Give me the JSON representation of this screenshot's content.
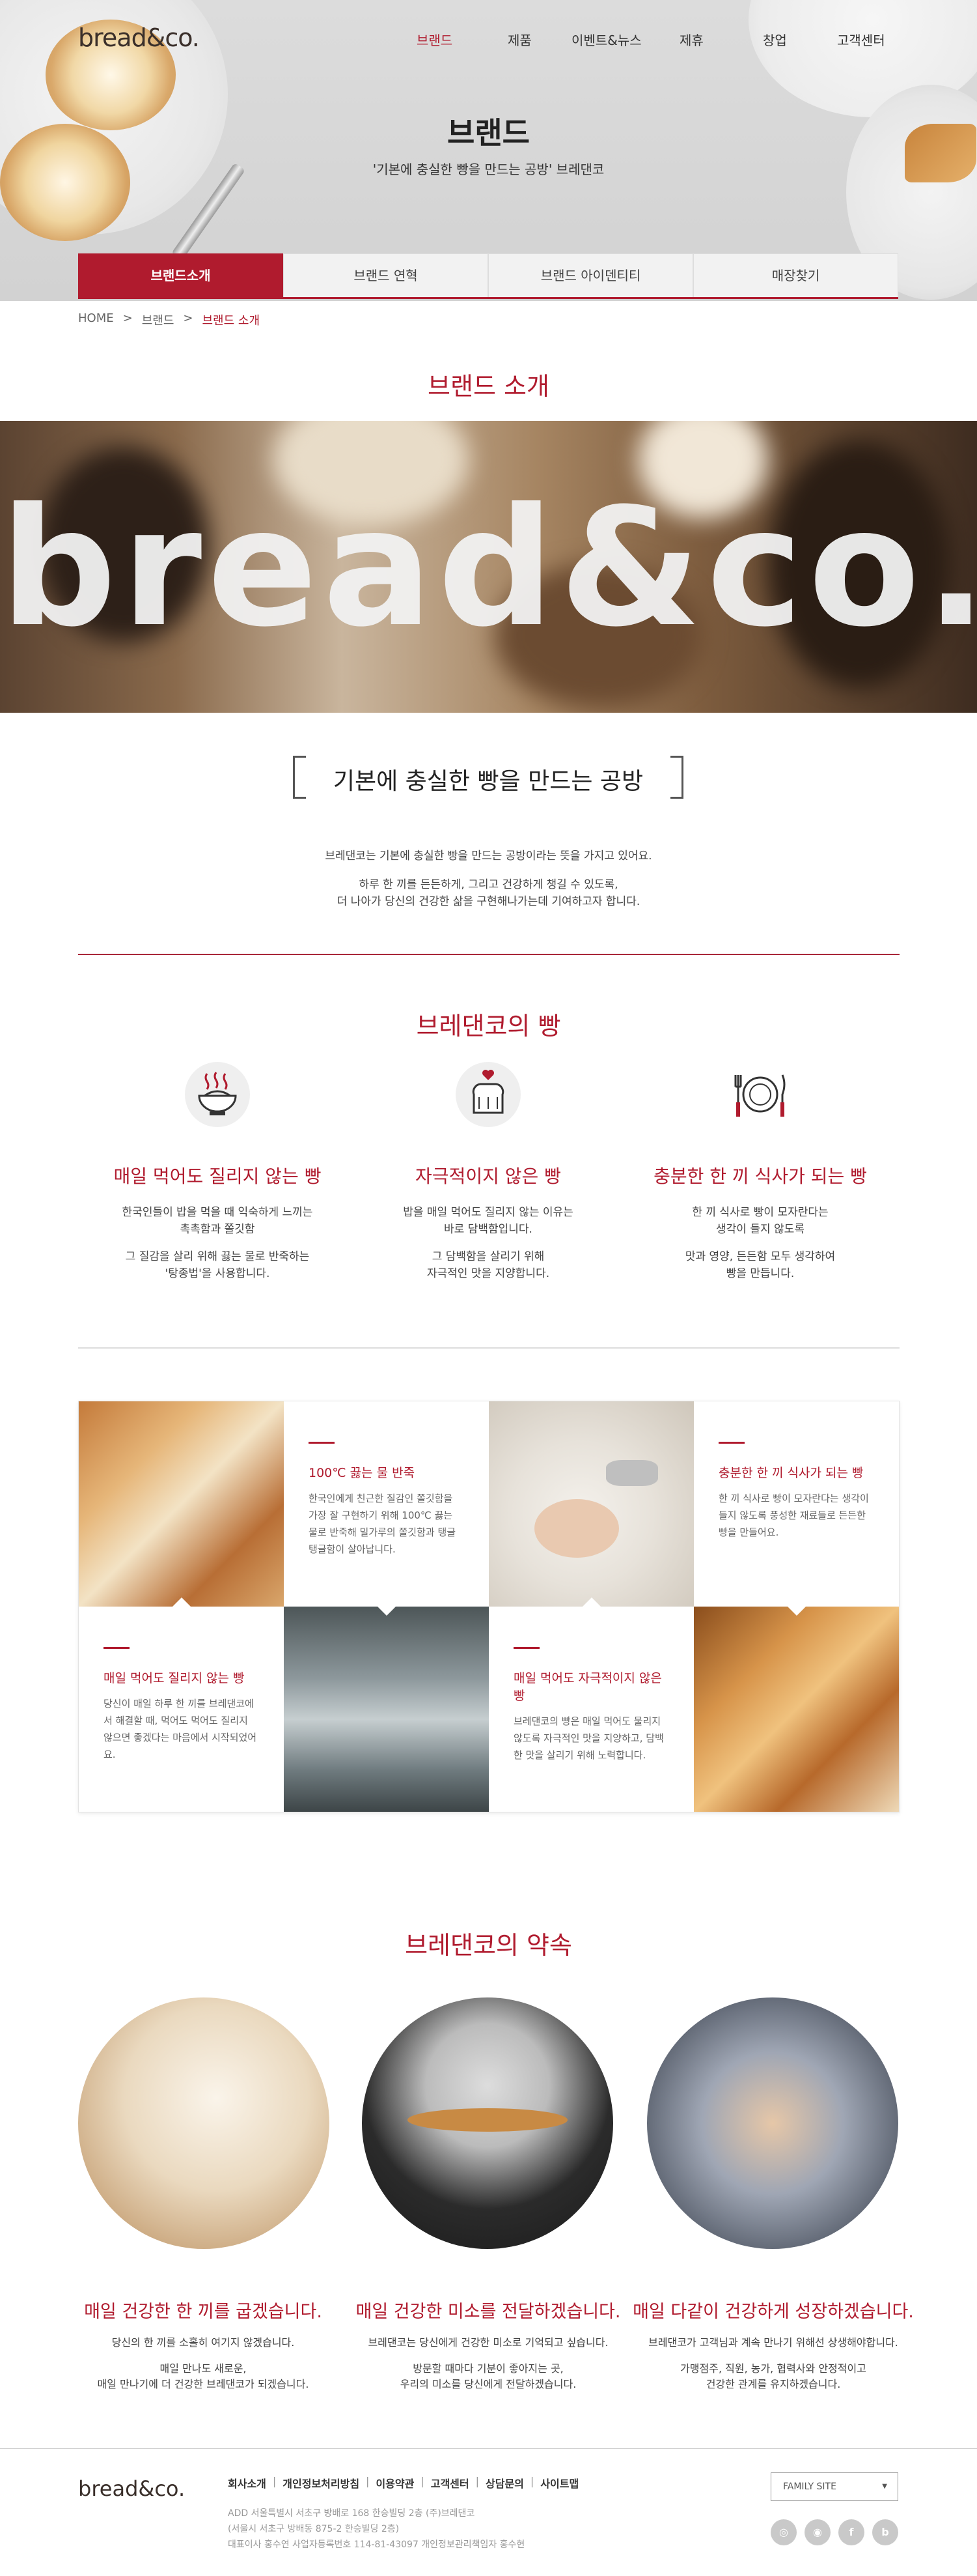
{
  "header": {
    "logo": "bread&co.",
    "nav": [
      "브랜드",
      "제품",
      "이벤트&뉴스",
      "제휴",
      "창업",
      "고객센터"
    ],
    "active_nav": 0,
    "title": "브랜드",
    "subtitle": "'기본에 충실한 빵을 만드는 공방' 브레댄코"
  },
  "tabs": [
    "브랜드소개",
    "브랜드 연혁",
    "브랜드 아이덴티티",
    "매장찾기"
  ],
  "breadcrumb": [
    "HOME",
    ">",
    "브랜드",
    ">",
    "브랜드 소개"
  ],
  "section1": {
    "title": "브랜드 소개",
    "banner_text": "bread&co.",
    "bracket_title": "기본에 충실한 빵을 만드는 공방",
    "para1": "브레댄코는 기본에 충실한 빵을 만드는 공방이라는 뜻을 가지고 있어요.",
    "para2": "하루 한 끼를 든든하게, 그리고 건강하게 챙길 수 있도록,",
    "para3": "더 나아가 당신의 건강한 삶을 구현해나가는데 기여하고자 합니다."
  },
  "section2": {
    "title": "브레댄코의 빵",
    "features": [
      {
        "icon": "rice-bowl-icon",
        "title": "매일 먹어도 질리지 않는 빵",
        "line1": "한국인들이 밥을 먹을 때 익숙하게 느끼는",
        "line2": "촉촉함과 쫄깃함",
        "line3": "그 질감을 살리 위해 끓는 물로 반죽하는",
        "line4": "'탕종법'을 사용합니다."
      },
      {
        "icon": "bread-heart-icon",
        "title": "자극적이지 않은 빵",
        "line1": "밥을 매일 먹어도 질리지 않는 이유는",
        "line2": "바로 담백함입니다.",
        "line3": "그 담백함을 살리기 위해",
        "line4": "자극적인 맛을 지양합니다."
      },
      {
        "icon": "plate-utensils-icon",
        "title": "충분한 한 끼 식사가 되는 빵",
        "line1": "한 끼 식사로 빵이 모자란다는",
        "line2": "생각이 들지 않도록",
        "line3": "맛과 영양, 든든함 모두 생각하여",
        "line4": "빵을 만듭니다."
      }
    ],
    "grid": [
      {
        "title": "100℃ 끓는 물 반죽",
        "desc": "한국인에게 친근한 질감인 쫄깃함을 가장 잘 구현하기 위해 100℃ 끓는 물로 반죽해 밀가루의 쫄깃함과 탱글탱글함이 살아납니다."
      },
      {
        "title": "충분한 한 끼 식사가 되는 빵",
        "desc": "한 끼 식사로 빵이 모자란다는 생각이 들지 않도록 풍성한 재료들로 든든한 빵을 만들어요."
      },
      {
        "title": "매일 먹어도 질리지 않는 빵",
        "desc": "당신이 매일 하루 한 끼를 브레댄코에서 해결할 때, 먹어도 먹어도 질리지 않으면 좋겠다는 마음에서 시작되었어요."
      },
      {
        "title": "매일 먹어도 자극적이지 않은 빵",
        "desc": "브레댄코의 빵은 매일 먹어도 물리지 않도록 자극적인 맛을 지양하고, 담백한 맛을 살리기 위해 노력합니다."
      }
    ]
  },
  "section3": {
    "title": "브레댄코의 약속",
    "promises": [
      {
        "title": "매일 건강한 한 끼를 굽겠습니다.",
        "line1": "당신의 한 끼를 소홀히 여기지 않겠습니다.",
        "line2": "매일 만나도 새로운,",
        "line3": "매일 만나기에 더 건강한 브레댄코가 되겠습니다."
      },
      {
        "title": "매일 건강한 미소를 전달하겠습니다.",
        "line1": "브레댄코는 당신에게 건강한 미소로 기억되고 싶습니다.",
        "line2": "방문할 때마다 기분이 좋아지는 곳,",
        "line3": "우리의 미소를 당신에게 전달하겠습니다."
      },
      {
        "title": "매일 다같이 건강하게 성장하겠습니다.",
        "line1": "브레댄코가 고객님과 계속 만나기 위해선 상생해야합니다.",
        "line2": "가맹점주, 직원, 농가, 협력사와 안정적이고",
        "line3": "건강한 관계를 유지하겠습니다."
      }
    ]
  },
  "footer": {
    "logo": "bread&co.",
    "links": [
      "회사소개",
      "개인정보처리방침",
      "이용약관",
      "고객센터",
      "상담문의",
      "사이트맵"
    ],
    "addr1": "ADD 서울특별시 서초구 방배로 168 한승빌딩 2층 (주)브레댄코",
    "addr2": "(서울시 서초구 방배동 875-2 한승빌딩 2층)",
    "addr3": "대표이사 홍수연    사업자등록번호 114-81-43097    개인정보관리책임자 홍수현",
    "family_site": "FAMILY SITE",
    "sns": [
      "instagram-icon",
      "instagram-icon",
      "facebook-icon",
      "blog-icon"
    ]
  },
  "colors": {
    "accent": "#b01b2e"
  }
}
